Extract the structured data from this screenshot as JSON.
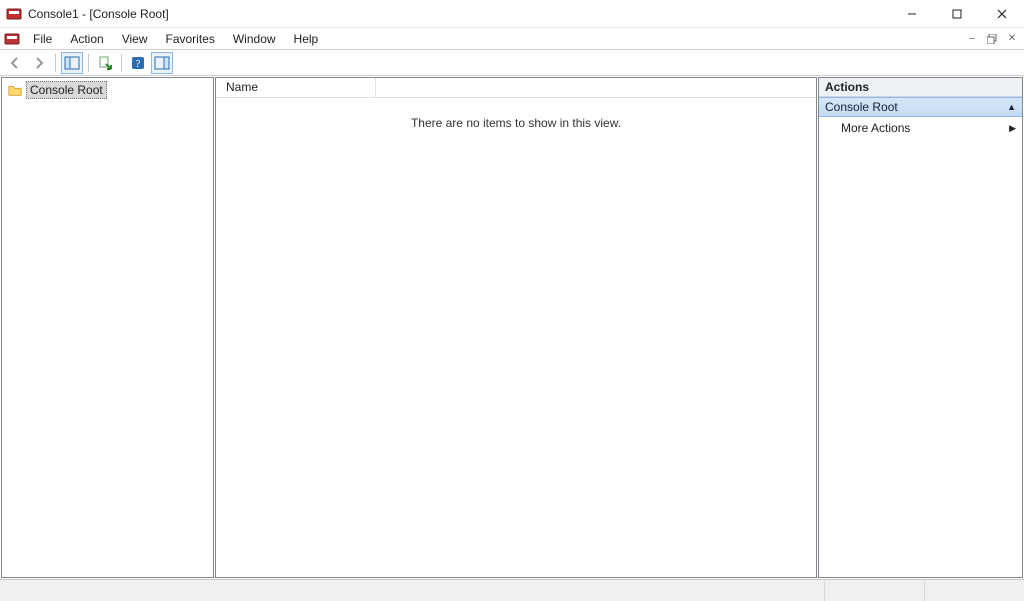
{
  "window": {
    "title": "Console1 - [Console Root]"
  },
  "menu": {
    "items": [
      "File",
      "Action",
      "View",
      "Favorites",
      "Window",
      "Help"
    ]
  },
  "tree": {
    "root_label": "Console Root"
  },
  "content": {
    "columns": [
      "Name"
    ],
    "empty_message": "There are no items to show in this view."
  },
  "actions": {
    "title": "Actions",
    "section": "Console Root",
    "more_actions": "More Actions"
  }
}
